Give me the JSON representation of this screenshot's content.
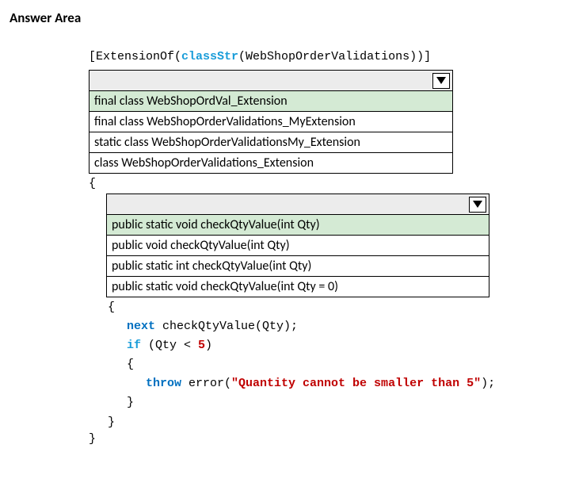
{
  "title": "Answer Area",
  "attributeLine": {
    "open": "[ExtensionOf(",
    "classStr": "classStr",
    "middle": "(WebShopOrderValidations))]"
  },
  "dropdown1": {
    "options": [
      "final class WebShopOrdVal_Extension",
      "final class WebShopOrderValidations_MyExtension",
      "static class WebShopOrderValidationsMy_Extension",
      "class WebShopOrderValidations_Extension"
    ]
  },
  "brace_open": "{",
  "dropdown2": {
    "options": [
      "public static void checkQtyValue(int Qty)",
      "public void checkQtyValue(int Qty)",
      "public static int checkQtyValue(int Qty)",
      "public static void checkQtyValue(int Qty = 0)"
    ]
  },
  "inner_brace_open": "{",
  "code": {
    "next_kw": "next",
    "next_rest": " checkQtyValue(Qty);",
    "if_kw": "if",
    "if_open": " (Qty < ",
    "if_num": "5",
    "if_close": ")",
    "brace_open": "{",
    "throw_kw": "throw",
    "error_fn": " error(",
    "error_str": "\"Quantity cannot be smaller than 5\"",
    "error_close": ");",
    "brace_close": "}"
  },
  "inner_brace_close": "}",
  "brace_close": "}"
}
